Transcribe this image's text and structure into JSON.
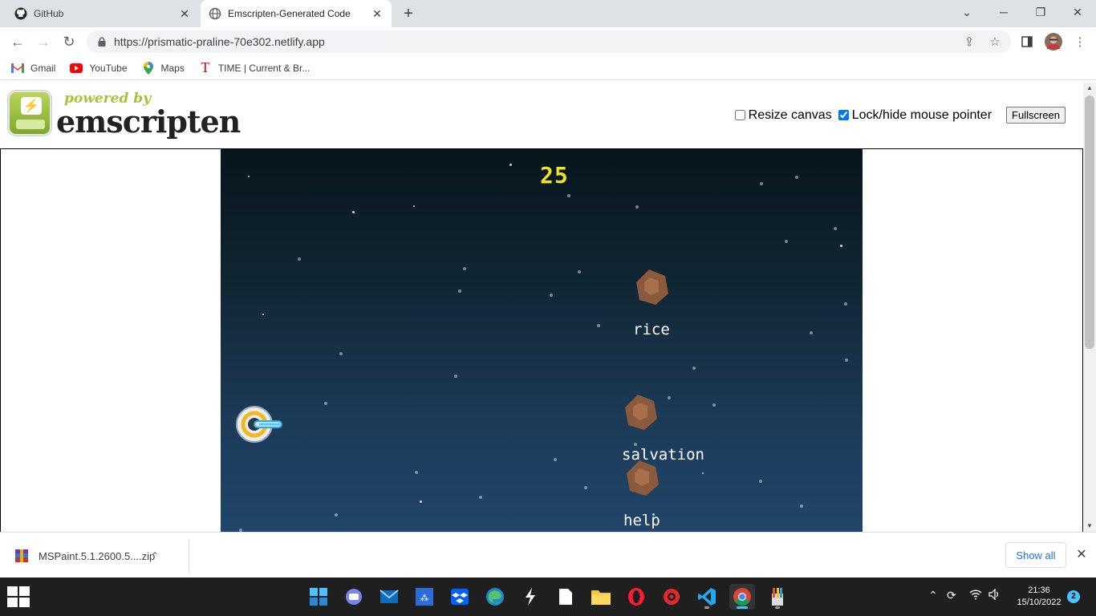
{
  "browser": {
    "tabs": [
      {
        "title": "GitHub",
        "icon": "github-icon"
      },
      {
        "title": "Emscripten-Generated Code",
        "icon": "globe-icon"
      }
    ],
    "url": "https://prismatic-praline-70e302.netlify.app",
    "bookmarks": [
      {
        "label": "Gmail",
        "icon": "gmail-icon"
      },
      {
        "label": "YouTube",
        "icon": "youtube-icon"
      },
      {
        "label": "Maps",
        "icon": "maps-icon"
      },
      {
        "label": "TIME | Current & Br...",
        "icon": "time-icon"
      }
    ]
  },
  "page": {
    "logo_powered": "powered by",
    "logo_name": "emscripten",
    "resize_canvas_label": "Resize canvas",
    "resize_canvas_checked": false,
    "lock_pointer_label": "Lock/hide mouse pointer",
    "lock_pointer_checked": true,
    "fullscreen_label": "Fullscreen"
  },
  "game": {
    "score": "25",
    "words": [
      "rice",
      "salvation",
      "help"
    ]
  },
  "downloads": {
    "file_name": "MSPaint.5.1.2600.5....zip",
    "show_all_label": "Show all"
  },
  "taskbar": {
    "time": "21:36",
    "date": "15/10/2022",
    "notification_count": "2"
  },
  "colors": {
    "score": "#f3e51d",
    "asteroid": "#8b5a3c",
    "accent": "#1a73e8"
  }
}
